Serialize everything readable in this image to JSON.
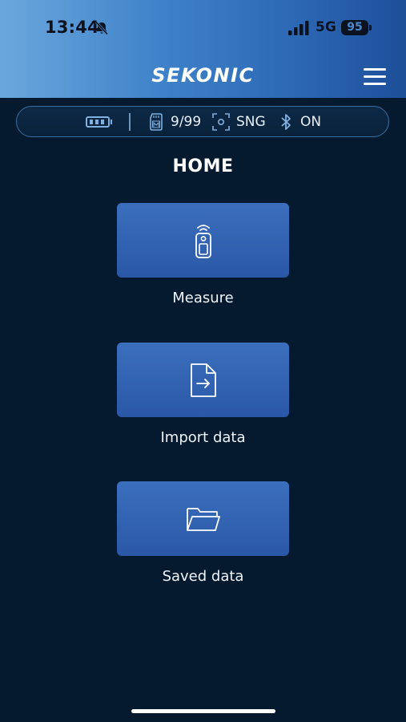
{
  "status_bar": {
    "time": "13:44",
    "network": "5G",
    "battery_level": "95"
  },
  "header": {
    "brand": "SEKONIC"
  },
  "info_bar": {
    "memory": "9/99",
    "mode": "SNG",
    "bluetooth": "ON"
  },
  "page": {
    "title": "HOME"
  },
  "tiles": [
    {
      "label": "Measure",
      "icon": "light-meter-icon"
    },
    {
      "label": "Import data",
      "icon": "file-import-icon"
    },
    {
      "label": "Saved data",
      "icon": "folder-icon"
    }
  ],
  "colors": {
    "background": "#051a2f",
    "tile": "#3260b0",
    "header_start": "#6aa7dd",
    "header_end": "#1e4f99"
  }
}
